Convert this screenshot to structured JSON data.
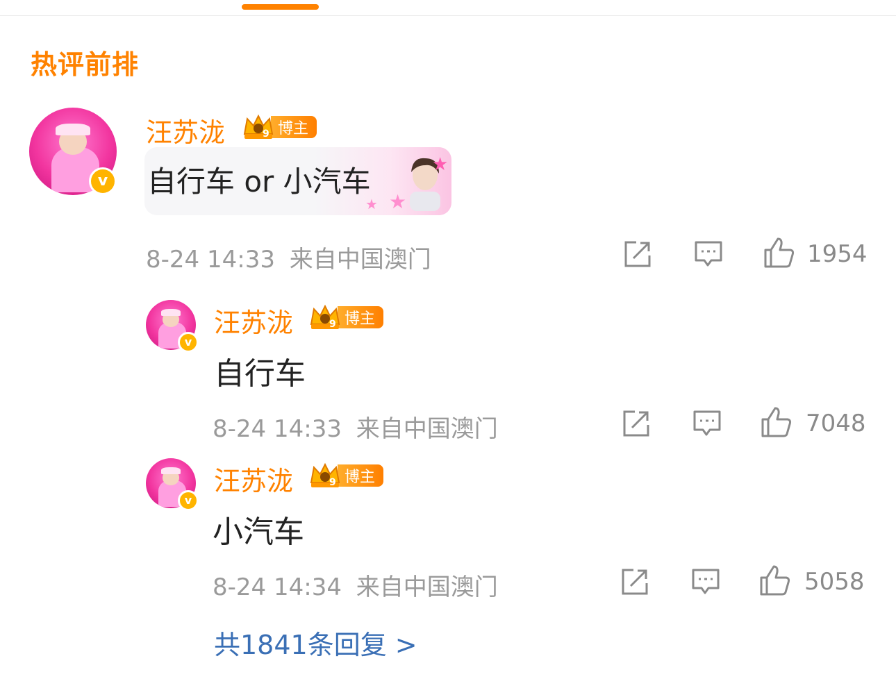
{
  "section_title": "热评前排",
  "comments": [
    {
      "username": "汪苏泷",
      "badge_label": "博主",
      "verified_glyph": "v",
      "text": "自行车 or 小汽车",
      "time": "8-24 14:33",
      "location": "来自中国澳门",
      "likes": "1954"
    },
    {
      "username": "汪苏泷",
      "badge_label": "博主",
      "verified_glyph": "v",
      "text": "自行车",
      "time": "8-24 14:33",
      "location": "来自中国澳门",
      "likes": "7048"
    },
    {
      "username": "汪苏泷",
      "badge_label": "博主",
      "verified_glyph": "v",
      "text": "小汽车",
      "time": "8-24 14:34",
      "location": "来自中国澳门",
      "likes": "5058"
    }
  ],
  "more_replies": "共1841条回复 >",
  "colors": {
    "accent": "#ff8200",
    "link": "#3a6fb5",
    "meta": "#9a9a9a"
  },
  "icons": [
    "share-icon",
    "comment-icon",
    "like-icon",
    "crown-icon",
    "verified-icon"
  ]
}
